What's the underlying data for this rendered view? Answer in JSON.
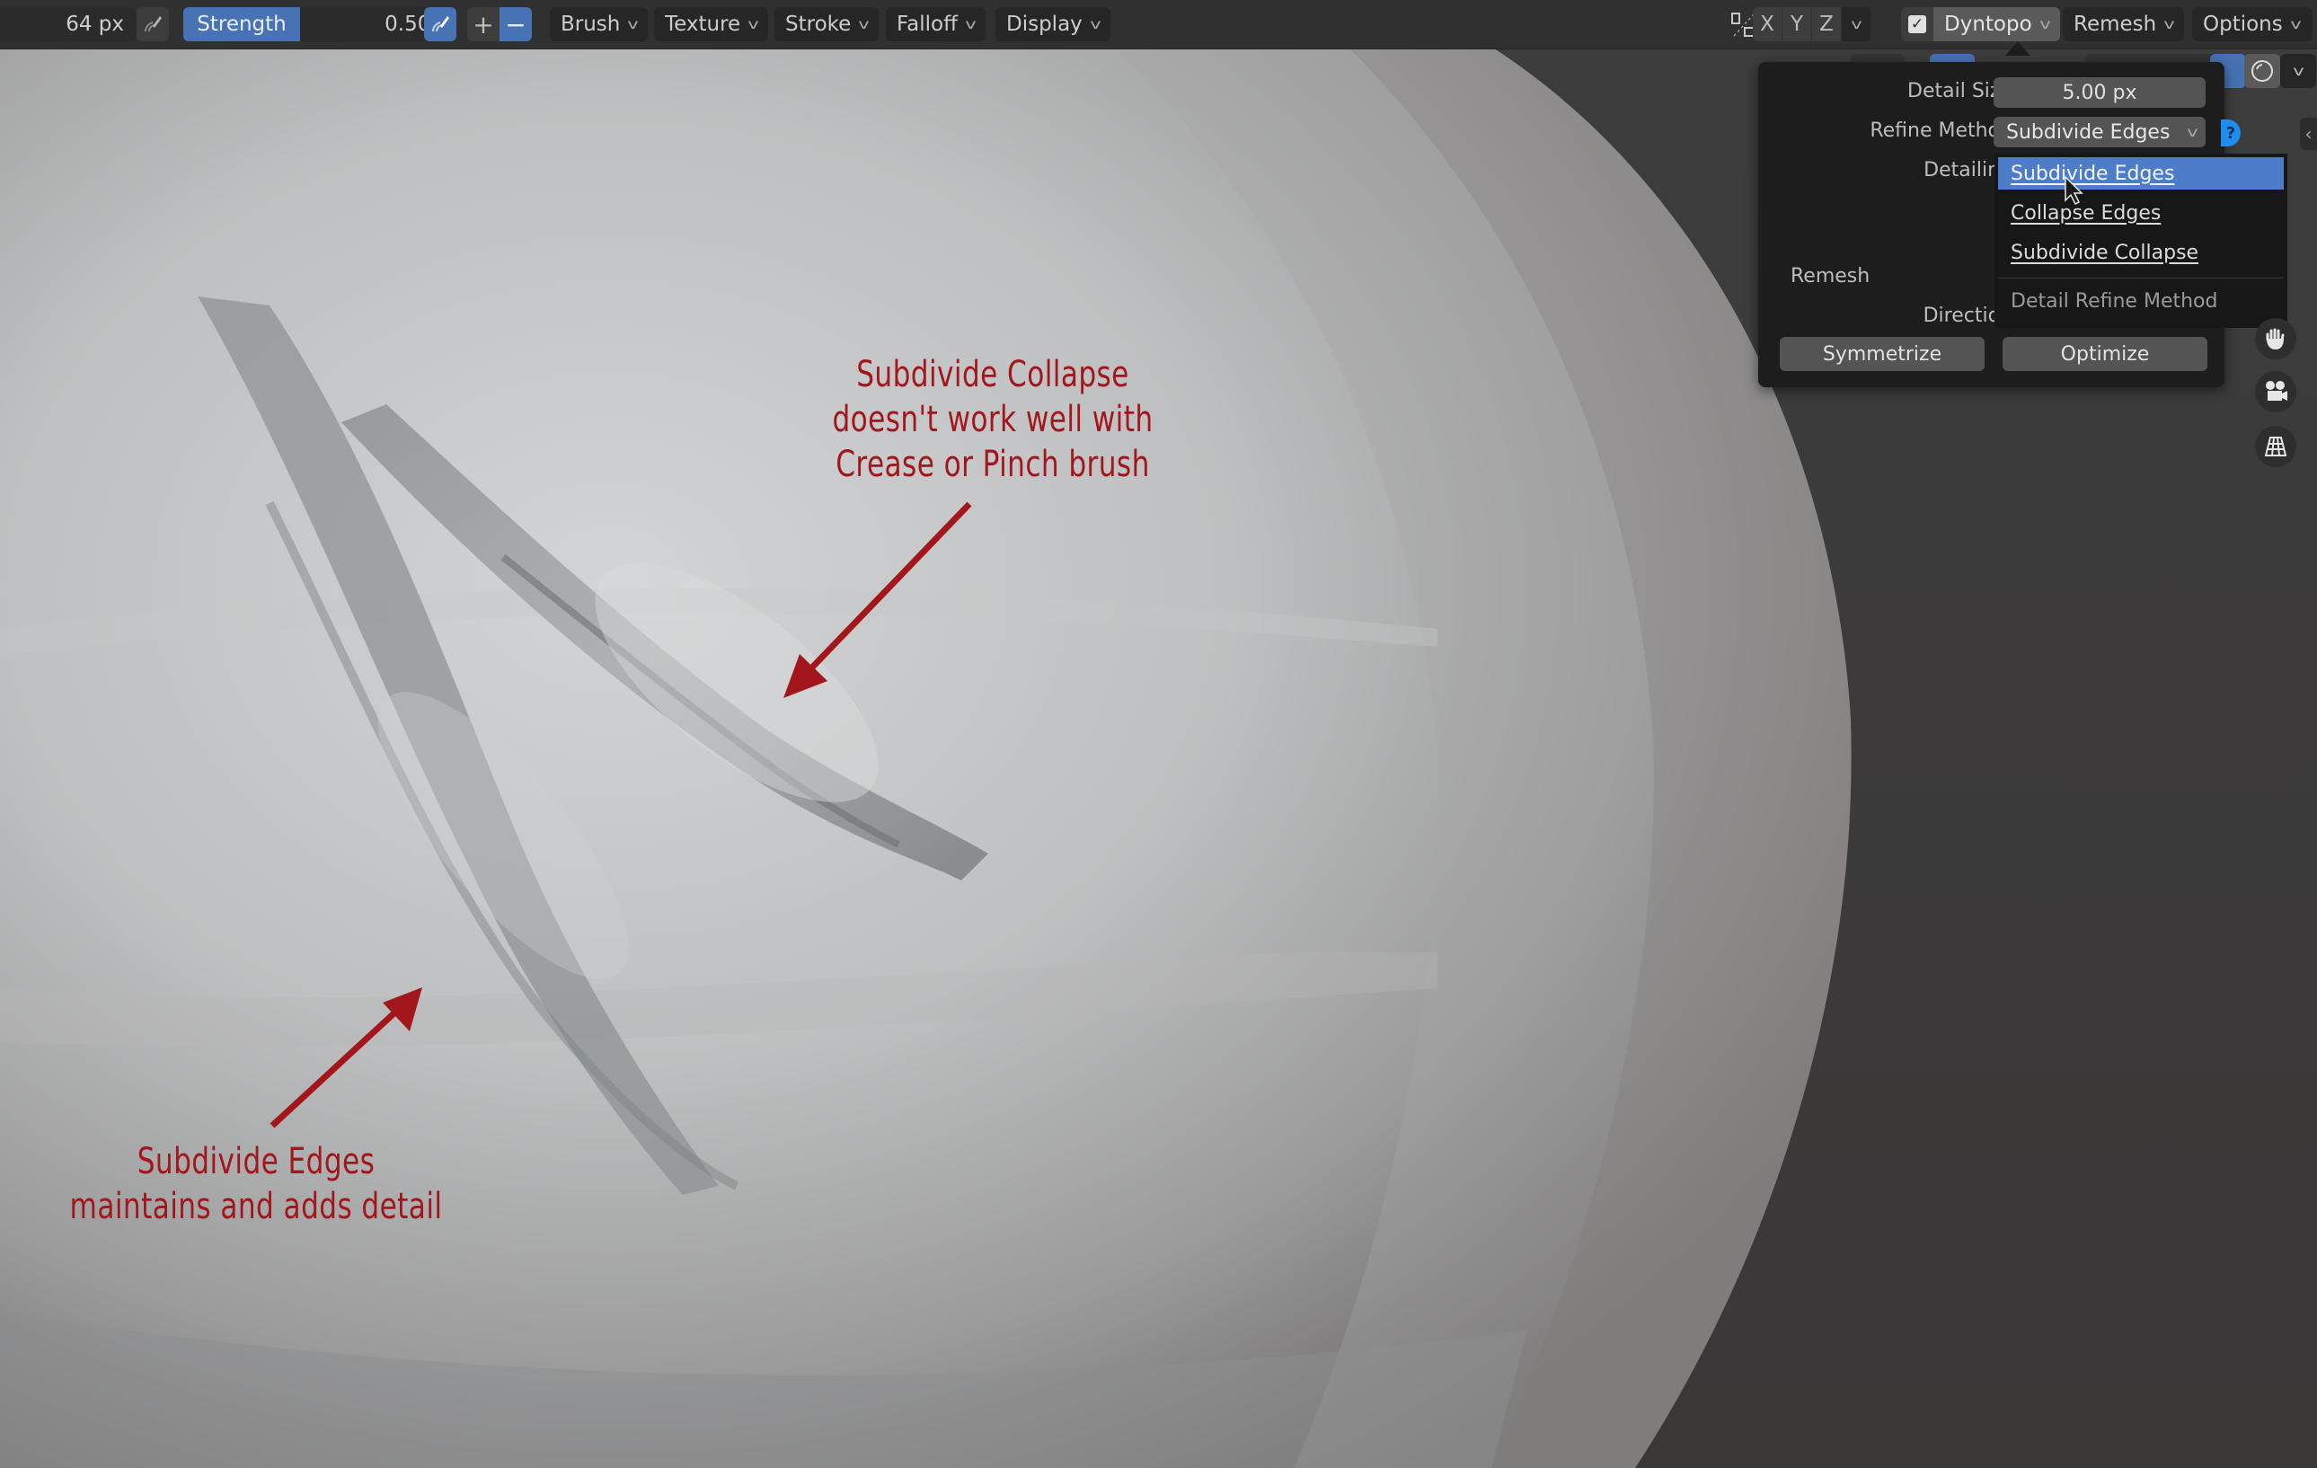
{
  "toolbar": {
    "radius_value": "64 px",
    "strength_label": "Strength",
    "strength_value": "0.500",
    "strength_fraction": 0.5,
    "plus_label": "+",
    "minus_label": "−",
    "menus": [
      {
        "label": "Brush"
      },
      {
        "label": "Texture"
      },
      {
        "label": "Stroke"
      },
      {
        "label": "Falloff"
      },
      {
        "label": "Display"
      }
    ],
    "axes": [
      "X",
      "Y",
      "Z"
    ],
    "dyntopo": {
      "label": "Dyntopo",
      "checked": true,
      "check_glyph": "✓"
    },
    "remesh_label": "Remesh",
    "options_label": "Options",
    "chevron_glyph": "v"
  },
  "dyntopo_panel": {
    "detail_size_label": "Detail Size",
    "detail_size_value": "5.00 px",
    "refine_method_label": "Refine Method",
    "refine_method_value": "Subdivide Edges",
    "detailing_label": "Detailing",
    "remesh_label": "Remesh",
    "direction_label": "Direction",
    "symmetrize_label": "Symmetrize",
    "optimize_label": "Optimize",
    "help_glyph": "?",
    "collapse_glyph": "‹"
  },
  "dropdown": {
    "items": [
      {
        "label": "Subdivide Edges",
        "active": true
      },
      {
        "label": "Collapse Edges",
        "active": false
      },
      {
        "label": "Subdivide Collapse",
        "active": false
      }
    ],
    "title": "Detail Refine Method"
  },
  "nav_icons": [
    "hand-icon",
    "camera-icon",
    "grid-icon"
  ],
  "annotations": [
    {
      "lines": [
        "Subdivide Collapse",
        "doesn't work well with",
        "Crease or Pinch brush"
      ]
    },
    {
      "lines": [
        "Subdivide Edges",
        "maintains and adds detail"
      ]
    }
  ],
  "colors": {
    "accent_blue": "#4772b3",
    "annotation_red": "#a3161b",
    "panel_bg": "#1d1d1d",
    "toolbar_bg": "#303030"
  }
}
